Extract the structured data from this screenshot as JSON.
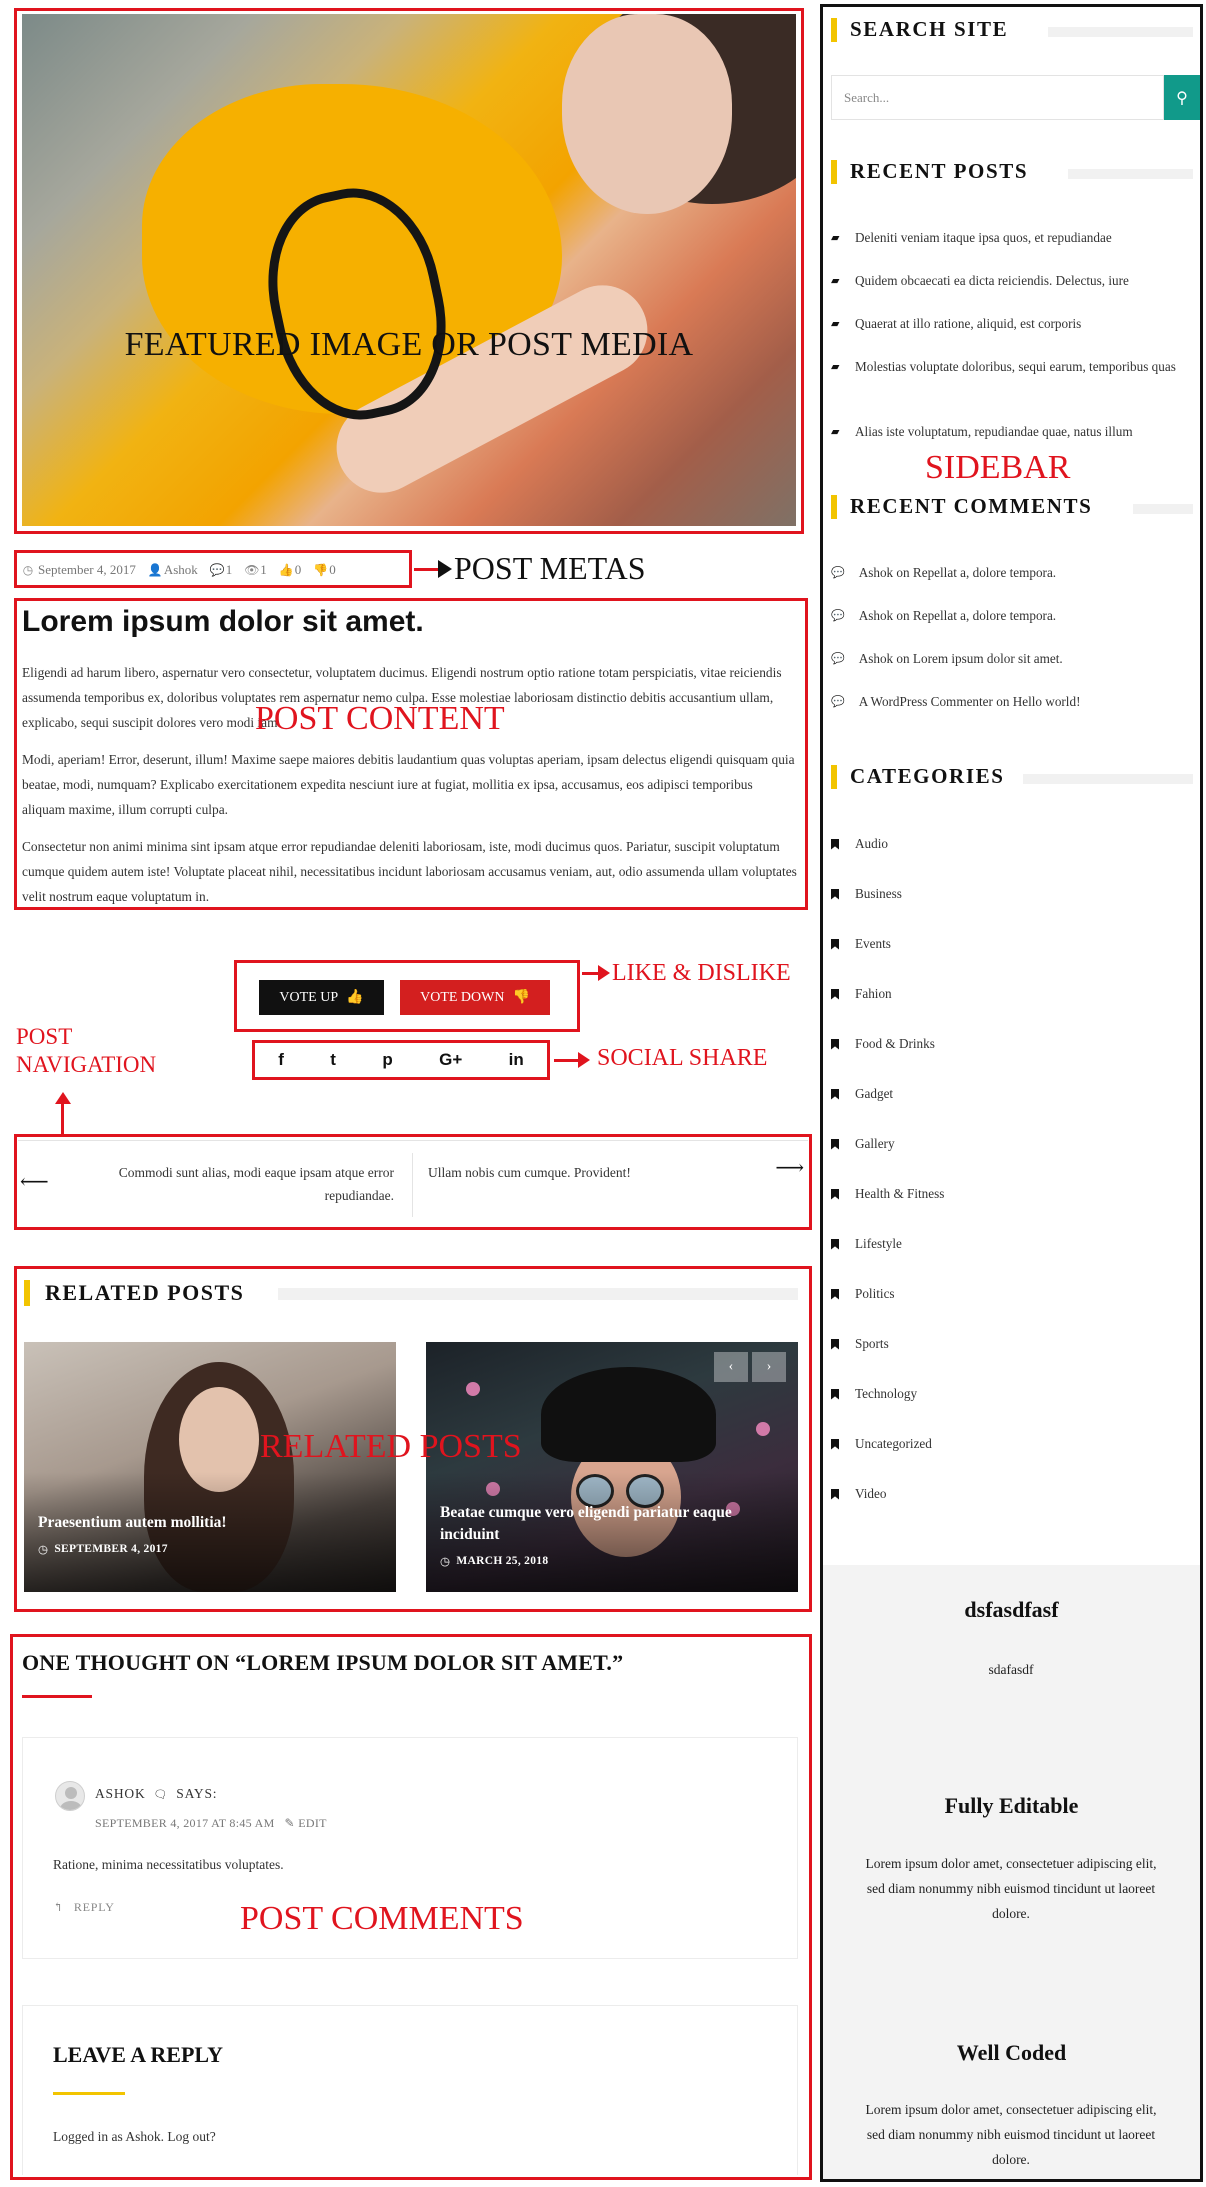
{
  "featured": {
    "caption": "FEATURED IMAGE OR POST MEDIA"
  },
  "annotations": {
    "post_metas": "POST METAS",
    "post_content": "POST CONTENT",
    "like_dislike": "LIKE & DISLIKE",
    "social_share": "SOCIAL SHARE",
    "post_navigation_1": "POST",
    "post_navigation_2": "NAVIGATION",
    "related_posts": "RELATED POSTS",
    "post_comments": "POST COMMENTS",
    "sidebar": "SIDEBAR",
    "color": "#e0141e"
  },
  "metas": {
    "date": "September 4, 2017",
    "author": "Ashok",
    "comments": "1",
    "views": "1",
    "likes": "0",
    "dislikes": "0"
  },
  "post": {
    "title": "Lorem ipsum dolor sit amet.",
    "paragraphs": [
      "Eligendi ad harum libero, aspernatur vero consectetur, voluptatem ducimus. Eligendi nostrum optio ratione totam perspiciatis, vitae reiciendis assumenda temporibus ex, doloribus voluptates rem aspernatur nemo culpa. Esse molestiae laboriosam distinctio debitis accusantium ullam, explicabo, sequi suscipit dolores vero modi iam.",
      "Modi, aperiam! Error, deserunt, illum! Maxime saepe maiores debitis laudantium quas voluptas aperiam, ipsam delectus eligendi quisquam quia beatae, modi, numquam? Explicabo exercitationem expedita nesciunt iure at fugiat, mollitia ex ipsa, accusamus, eos adipisci temporibus aliquam maxime, illum corrupti culpa.",
      "Consectetur non animi minima sint ipsam atque error repudiandae deleniti laboriosam, iste, modi ducimus quos. Pariatur, suscipit voluptatum cumque quidem autem iste! Voluptate placeat nihil, necessitatibus incidunt laboriosam accusamus veniam, aut, odio assumenda ullam voluptates velit nostrum eaque voluptatum in."
    ]
  },
  "vote": {
    "up": "VOTE UP",
    "down": "VOTE DOWN"
  },
  "social": {
    "icons": [
      "f",
      "t",
      "p",
      "G+",
      "in"
    ]
  },
  "post_nav": {
    "prev": "Commodi sunt alias, modi eaque ipsam atque error repudiandae.",
    "next": "Ullam nobis cum cumque. Provident!"
  },
  "related": {
    "title": "RELATED POSTS",
    "posts": [
      {
        "title": "Praesentium autem mollitia!",
        "date": "SEPTEMBER 4, 2017"
      },
      {
        "title": "Beatae cumque vero eligendi pariatur eaque inciduint",
        "date": "MARCH 25, 2018"
      }
    ]
  },
  "comments": {
    "title": "ONE THOUGHT ON “LOREM IPSUM DOLOR SIT AMET.”",
    "author": "ASHOK",
    "says": "SAYS:",
    "date": "SEPTEMBER 4, 2017 AT 8:45 AM",
    "edit": "EDIT",
    "text": "Ratione, minima necessitatibus voluptates.",
    "reply": "REPLY"
  },
  "leave_reply": {
    "title": "LEAVE A REPLY",
    "logged": "Logged in as Ashok. Log out?"
  },
  "sidebar": {
    "search_title": "SEARCH SITE",
    "search_placeholder": "Search...",
    "recent_posts_title": "RECENT POSTS",
    "recent_posts": [
      "Deleniti veniam itaque ipsa quos, et repudiandae",
      "Quidem obcaecati ea dicta reiciendis. Delectus, iure",
      "Quaerat at illo ratione, aliquid, est corporis",
      "Molestias voluptate doloribus, sequi earum, temporibus quas",
      "Alias iste voluptatum, repudiandae quae, natus illum"
    ],
    "recent_comments_title": "RECENT COMMENTS",
    "recent_comments": [
      "Ashok on Repellat a, dolore tempora.",
      "Ashok on Repellat a, dolore tempora.",
      "Ashok on Lorem ipsum dolor sit amet.",
      "A WordPress Commenter on Hello world!"
    ],
    "categories_title": "CATEGORIES",
    "categories": [
      "Audio",
      "Business",
      "Events",
      "Fahion",
      "Food & Drinks",
      "Gadget",
      "Gallery",
      "Health & Fitness",
      "Lifestyle",
      "Politics",
      "Sports",
      "Technology",
      "Uncategorized",
      "Video"
    ],
    "widgets": [
      {
        "title": "dsfasdfasf",
        "text": "sdafasdf"
      },
      {
        "title": "Fully Editable",
        "text": "Lorem ipsum dolor amet, consectetuer adipiscing elit, sed diam nonummy nibh euismod tincidunt ut laoreet dolore."
      },
      {
        "title": "Well Coded",
        "text": "Lorem ipsum dolor amet, consectetuer adipiscing elit, sed diam nonummy nibh euismod tincidunt ut laoreet dolore."
      }
    ]
  }
}
